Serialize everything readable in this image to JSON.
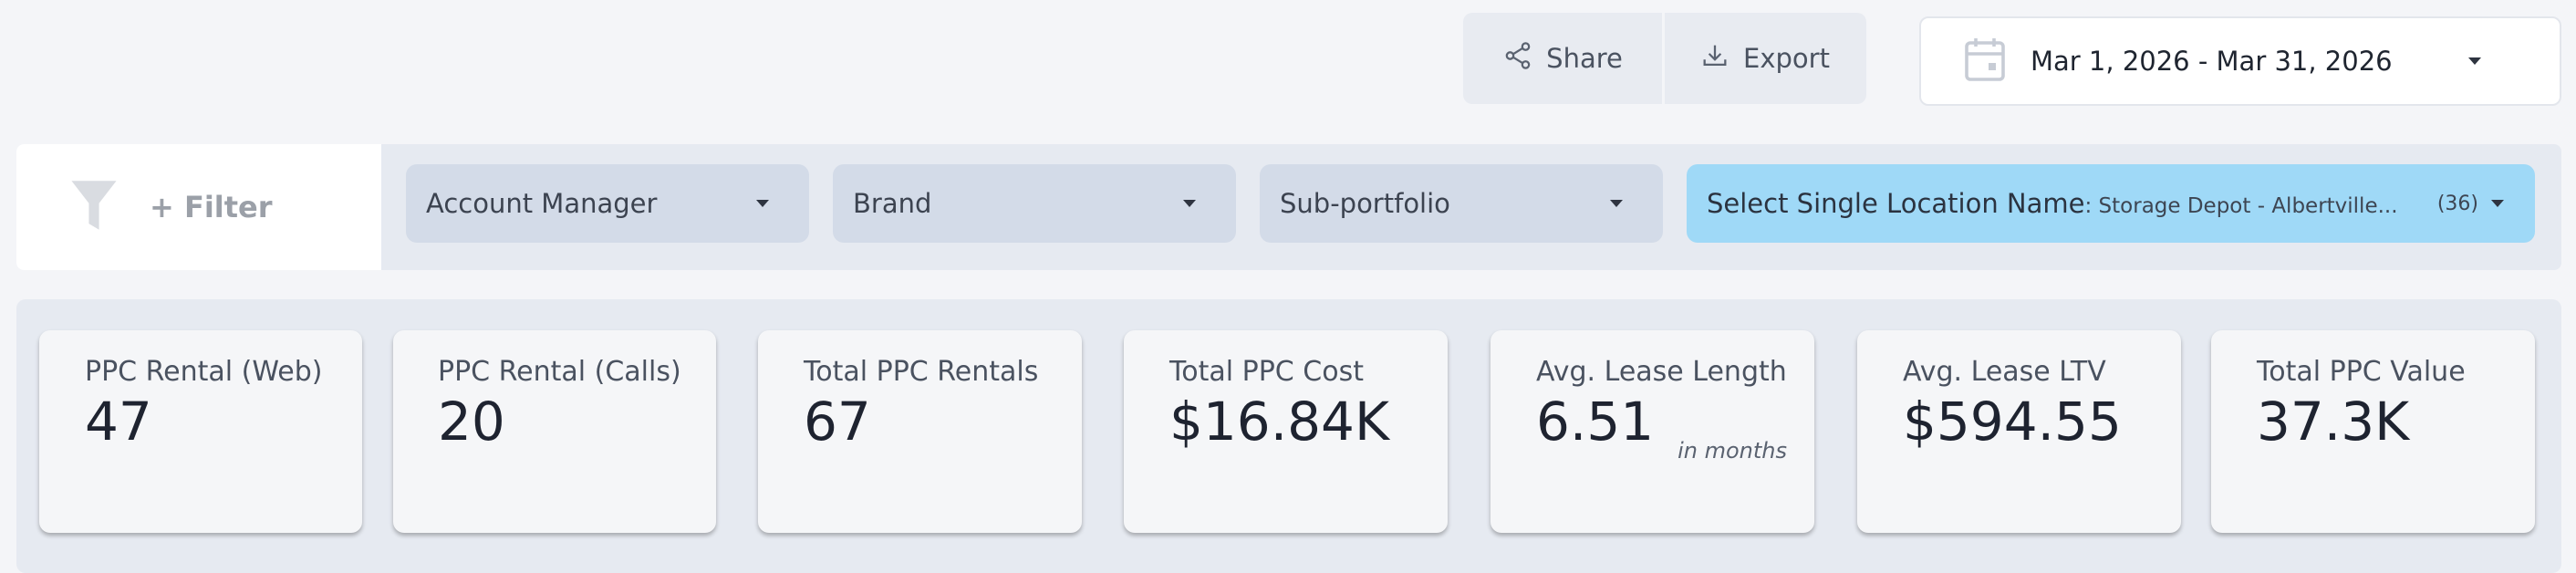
{
  "toolbar": {
    "share_label": "Share",
    "export_label": "Export"
  },
  "date_range": {
    "value": "Mar 1, 2026 - Mar 31, 2026"
  },
  "filters": {
    "add_filter_label": "+ Filter",
    "dropdowns": [
      {
        "label": "Account Manager"
      },
      {
        "label": "Brand"
      },
      {
        "label": "Sub-portfolio"
      }
    ],
    "location": {
      "label": "Select Single Location Name",
      "selected": ": Storage Depot - Albertville...",
      "count": "(36)"
    }
  },
  "kpis": [
    {
      "label": "PPC Rental (Web)",
      "value": "47"
    },
    {
      "label": "PPC Rental (Calls)",
      "value": "20"
    },
    {
      "label": "Total PPC Rentals",
      "value": "67"
    },
    {
      "label": "Total PPC Cost",
      "value": "$16.84K"
    },
    {
      "label": "Avg. Lease Length",
      "value": "6.51",
      "unit": "in months"
    },
    {
      "label": "Avg. Lease LTV",
      "value": "$594.55"
    },
    {
      "label": "Total PPC Value",
      "value": "37.3K"
    }
  ],
  "colors": {
    "background": "#f4f5f8",
    "panel": "#e6eaf1",
    "dropdown": "#d3dbe8",
    "dropdown_active": "#9fd9f7"
  }
}
